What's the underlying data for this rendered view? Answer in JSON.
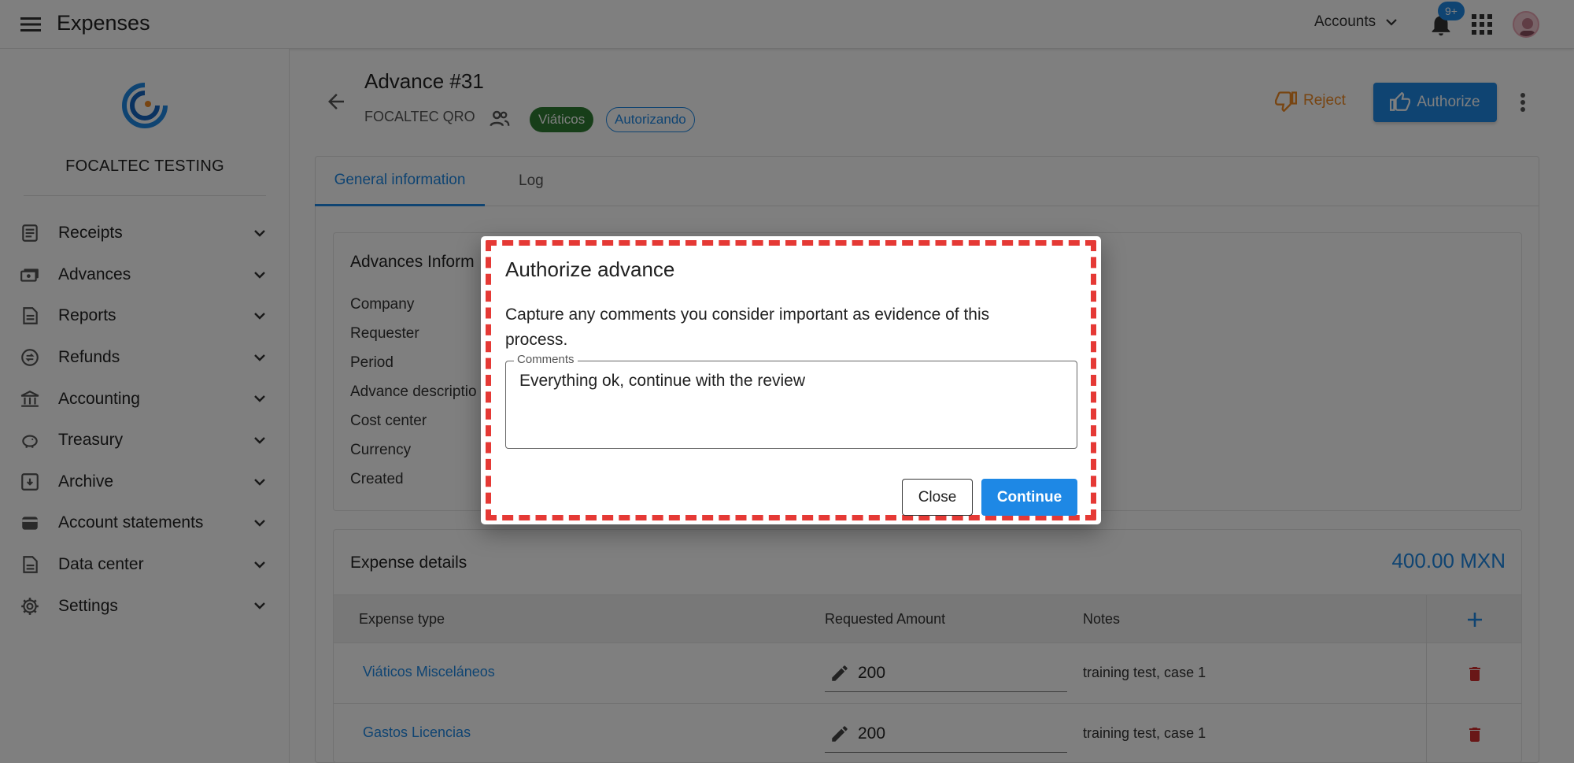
{
  "topbar": {
    "app_title": "Expenses",
    "accounts_label": "Accounts",
    "notification_badge": "9+"
  },
  "sidebar": {
    "company": "FOCALTEC TESTING",
    "items": [
      {
        "label": "Receipts",
        "icon": "receipt-icon"
      },
      {
        "label": "Advances",
        "icon": "cash-icon"
      },
      {
        "label": "Reports",
        "icon": "report-icon"
      },
      {
        "label": "Refunds",
        "icon": "refund-icon"
      },
      {
        "label": "Accounting",
        "icon": "bank-icon"
      },
      {
        "label": "Treasury",
        "icon": "piggy-bank-icon"
      },
      {
        "label": "Archive",
        "icon": "archive-icon"
      },
      {
        "label": "Account statements",
        "icon": "wallet-icon"
      },
      {
        "label": "Data center",
        "icon": "data-icon"
      },
      {
        "label": "Settings",
        "icon": "gear-icon"
      }
    ]
  },
  "header": {
    "title": "Advance #31",
    "subtitle": "FOCALTEC QRO",
    "chip_type": "Viáticos",
    "chip_status": "Autorizando",
    "reject_label": "Reject",
    "authorize_label": "Authorize"
  },
  "tabs": [
    {
      "label": "General information",
      "active": true
    },
    {
      "label": "Log",
      "active": false
    }
  ],
  "advances_info": {
    "title": "Advances Inform",
    "fields": [
      "Company",
      "Requester",
      "Period",
      "Advance descriptio",
      "Cost center",
      "Currency",
      "Created"
    ]
  },
  "expense_details": {
    "title": "Expense details",
    "total": "400.00 MXN",
    "columns": [
      "Expense type",
      "Requested Amount",
      "Notes"
    ],
    "rows": [
      {
        "type": "Viáticos Misceláneos",
        "amount": "200",
        "notes": "training test, case 1"
      },
      {
        "type": "Gastos Licencias",
        "amount": "200",
        "notes": "training test, case 1"
      }
    ]
  },
  "dialog": {
    "title": "Authorize advance",
    "text": "Capture any comments you consider important as evidence of this process.",
    "comments_label": "Comments",
    "comments_value": "Everything ok, continue with the review",
    "close_label": "Close",
    "continue_label": "Continue"
  },
  "colors": {
    "primary": "#1e88e5",
    "success": "#2e7d32",
    "warning": "#f08a24",
    "danger": "#d32f2f",
    "highlight": "#e53935"
  }
}
